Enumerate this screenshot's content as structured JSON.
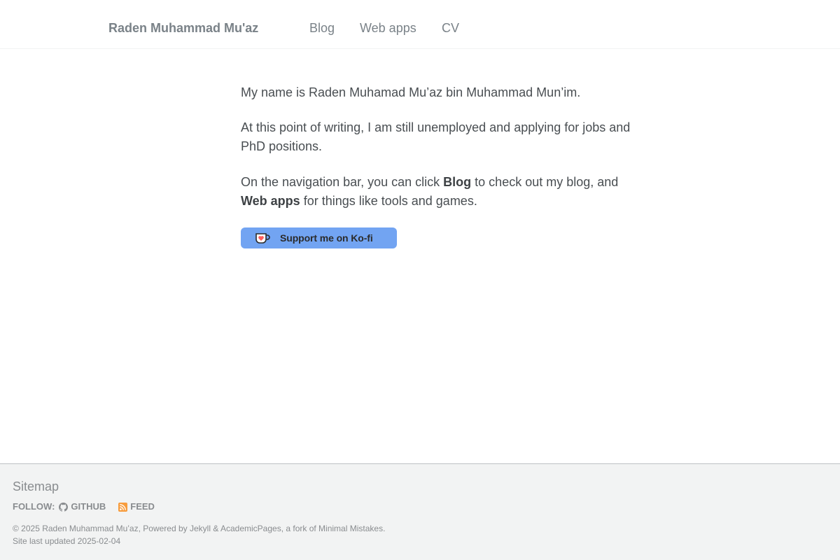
{
  "header": {
    "site_title": "Raden Muhammad Mu'az",
    "nav": {
      "blog": "Blog",
      "webapps": "Web apps",
      "cv": "CV"
    }
  },
  "main": {
    "p1": "My name is Raden Muhamad Mu’az bin Muhammad Mun’im.",
    "p2": "At this point of writing, I am still unemployed and applying for jobs and PhD positions.",
    "p3_part1": "On the navigation bar, you can click ",
    "p3_blog": "Blog",
    "p3_part2": " to check out my blog, and ",
    "p3_webapps": "Web apps",
    "p3_part3": " for things like tools and games.",
    "kofi_label": "Support me on Ko-fi",
    "kofi_icon": "kofi-cup-icon"
  },
  "footer": {
    "sitemap": "Sitemap",
    "follow_label": "FOLLOW:",
    "github": "GITHUB",
    "feed": "FEED",
    "copyright": "© 2025 Raden Muhammad Mu’az, Powered by Jekyll & AcademicPages, a fork of Minimal Mistakes.",
    "updated": "Site last updated 2025-02-04"
  },
  "colors": {
    "kofi_button": "#72a4f2",
    "kofi_heart": "#ff5e5b",
    "feed_icon": "#f79c3d",
    "text": "#494e52",
    "nav_text": "#7a8288"
  }
}
